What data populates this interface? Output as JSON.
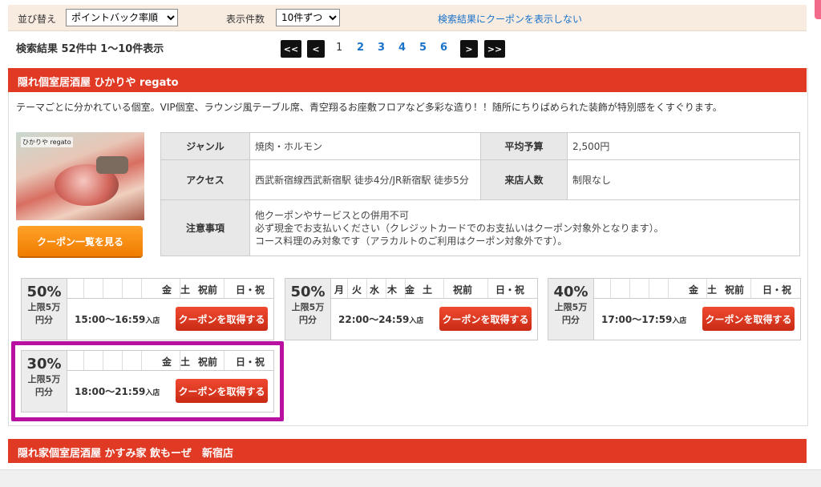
{
  "toolbar": {
    "sort_label": "並び替え",
    "sort_value": "ポイントバック率順",
    "count_label": "表示件数",
    "count_value": "10件ずつ",
    "hide_coupon_link": "検索結果にクーポンを表示しない"
  },
  "results": {
    "summary": "検索結果 52件中 1～10件表示",
    "first": "<<",
    "prev": "<",
    "pages": [
      "1",
      "2",
      "3",
      "4",
      "5",
      "6"
    ],
    "current_page": "1",
    "next": ">",
    "last": ">>"
  },
  "shop1": {
    "name": "隠れ個室居酒屋 ひかりや regato",
    "description": "テーマごとに分かれている個室。VIP個室、ラウンジ風テーブル席、青空翔るお座敷フロアなど多彩な造り！！随所にちりばめられた装飾が特別感をくすぐります。",
    "photo_label": "ひかりや regato",
    "coupon_list_button": "クーポン一覧を見る",
    "info": {
      "genre_label": "ジャンル",
      "genre": "焼肉・ホルモン",
      "budget_label": "平均予算",
      "budget": "2,500円",
      "access_label": "アクセス",
      "access": "西武新宿線西武新宿駅 徒歩4分/JR新宿駅 徒歩5分",
      "capacity_label": "来店人数",
      "capacity": "制限なし",
      "notes_label": "注意事項",
      "notes": [
        "他クーポンやサービスとの併用不可",
        "必ず現金でお支払いください（クレジットカードでのお支払いはクーポン対象外となります）。",
        "コース料理のみ対象です（アラカルトのご利用はクーポン対象外です）。"
      ]
    },
    "coupons": [
      {
        "percent": "50%",
        "limit1": "上限5万",
        "limit2": "円分",
        "days": [
          "金",
          "土",
          "祝前",
          "日・祝"
        ],
        "time": "15:00～16:59",
        "suffix": "入店",
        "button": "クーポンを取得する"
      },
      {
        "percent": "50%",
        "limit1": "上限5万",
        "limit2": "円分",
        "days": [
          "月",
          "火",
          "水",
          "木",
          "金",
          "土",
          "祝前",
          "日・祝"
        ],
        "time": "22:00～24:59",
        "suffix": "入店",
        "button": "クーポンを取得する"
      },
      {
        "percent": "40%",
        "limit1": "上限5万",
        "limit2": "円分",
        "days": [
          "金",
          "土",
          "祝前",
          "日・祝"
        ],
        "time": "17:00～17:59",
        "suffix": "入店",
        "button": "クーポンを取得する"
      },
      {
        "percent": "30%",
        "limit1": "上限5万",
        "limit2": "円分",
        "days": [
          "金",
          "土",
          "祝前",
          "日・祝"
        ],
        "time": "18:00～21:59",
        "suffix": "入店",
        "button": "クーポンを取得する"
      }
    ]
  },
  "shop2": {
    "name": "隠れ家個室居酒屋 かすみ家 飲もーぜ　新宿店"
  },
  "colors": {
    "header_red": "#e03a24",
    "button_orange": "#f07c00",
    "highlight_magenta": "#b9119f",
    "link_blue": "#1a73c9"
  }
}
